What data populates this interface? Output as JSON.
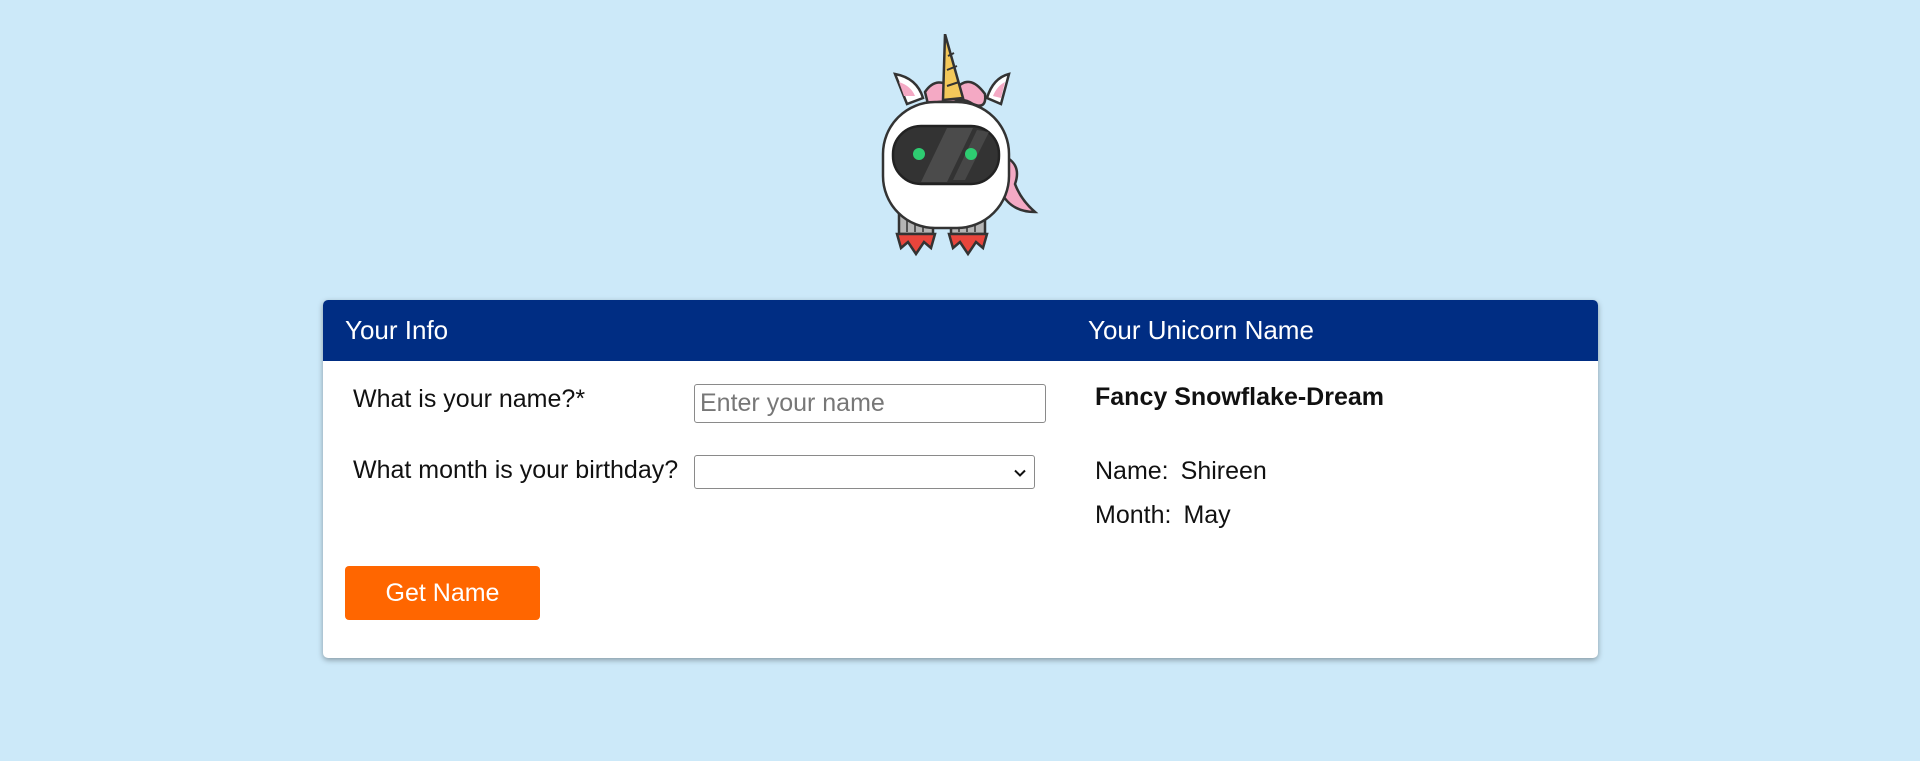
{
  "mascot": {
    "icon": "unicorn-robot-icon"
  },
  "form": {
    "title": "Your Info",
    "name_label": "What is your name?*",
    "name_value": "",
    "name_placeholder": "Enter your name",
    "month_label": "What month is your birthday?",
    "month_value": "",
    "submit_label": "Get Name"
  },
  "result": {
    "title": "Your Unicorn Name",
    "unicorn_name": "Fancy Snowflake-Dream",
    "name_key": "Name:",
    "name_value": "Shireen",
    "month_key": "Month:",
    "month_value": "May"
  },
  "colors": {
    "background": "#cce9f9",
    "header": "#002d83",
    "button": "#ff6600"
  }
}
